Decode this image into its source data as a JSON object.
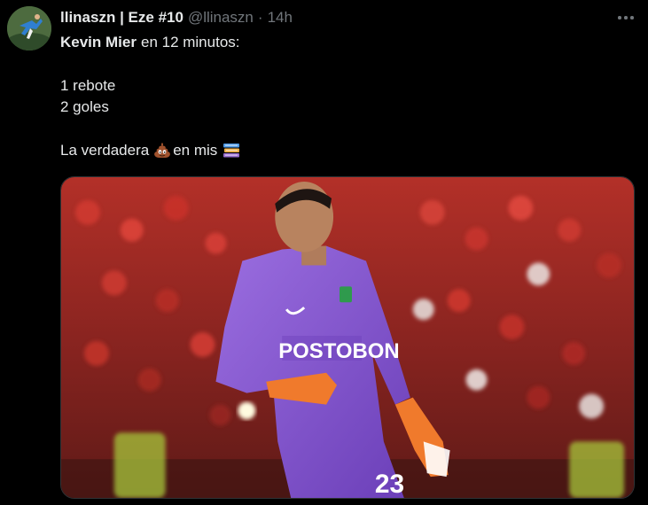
{
  "tweet": {
    "display_name": "llinaszn | Eze #10",
    "handle": "@llinaszn",
    "separator": "·",
    "time": "14h",
    "line1_bold": "Kevin Mier",
    "line1_rest": "en 12 minutos:",
    "line2": "1 rebote",
    "line3": "2 goles",
    "line4_start": "La verdadera",
    "line4_mid": "en mis",
    "emoji1": "pile-of-poo",
    "emoji2": "books",
    "media_jersey_text": "POSTOBON",
    "media_jersey_number": "23"
  }
}
